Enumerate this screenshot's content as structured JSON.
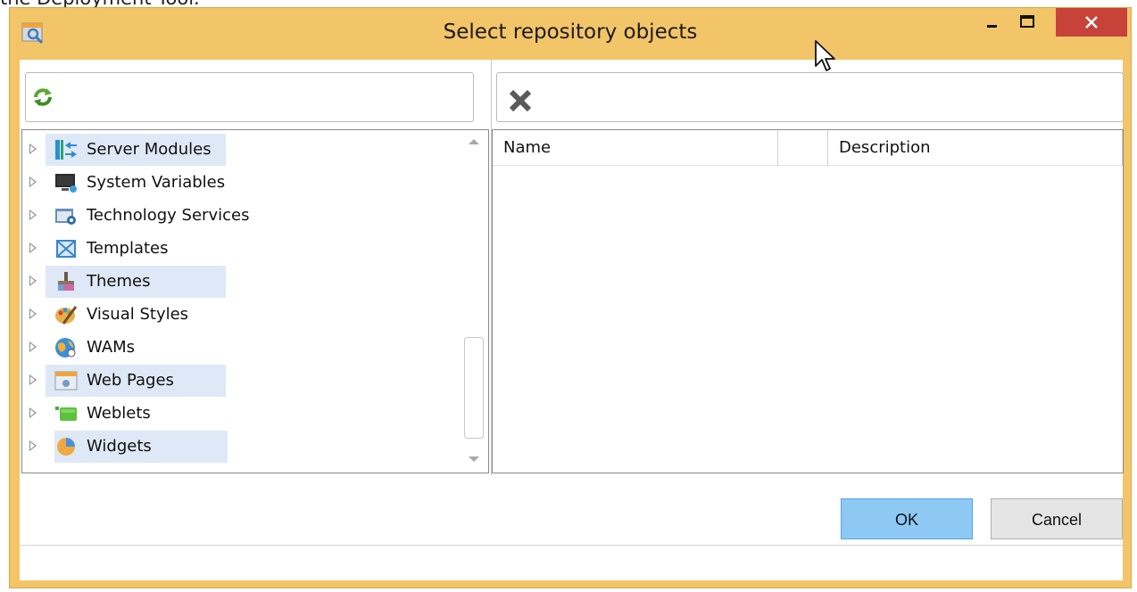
{
  "background_caption": "the Deployment Tool.",
  "window": {
    "title": "Select repository objects",
    "accent_color": "#f3c569",
    "close_color": "#c7433a"
  },
  "tree": {
    "items": [
      {
        "label": "Server Modules",
        "icon": "server-modules-icon",
        "highlighted": true
      },
      {
        "label": "System Variables",
        "icon": "system-variables-icon",
        "highlighted": false
      },
      {
        "label": "Technology Services",
        "icon": "technology-services-icon",
        "highlighted": false
      },
      {
        "label": "Templates",
        "icon": "templates-icon",
        "highlighted": false
      },
      {
        "label": "Themes",
        "icon": "themes-icon",
        "highlighted": true
      },
      {
        "label": "Visual Styles",
        "icon": "visual-styles-icon",
        "highlighted": false
      },
      {
        "label": "WAMs",
        "icon": "wams-icon",
        "highlighted": false
      },
      {
        "label": "Web Pages",
        "icon": "web-pages-icon",
        "highlighted": true
      },
      {
        "label": "Weblets",
        "icon": "weblets-icon",
        "highlighted": false
      },
      {
        "label": "Widgets",
        "icon": "widgets-icon",
        "highlighted": true
      }
    ]
  },
  "grid": {
    "columns": [
      "Name",
      "",
      "Description"
    ]
  },
  "buttons": {
    "ok": "OK",
    "cancel": "Cancel"
  }
}
